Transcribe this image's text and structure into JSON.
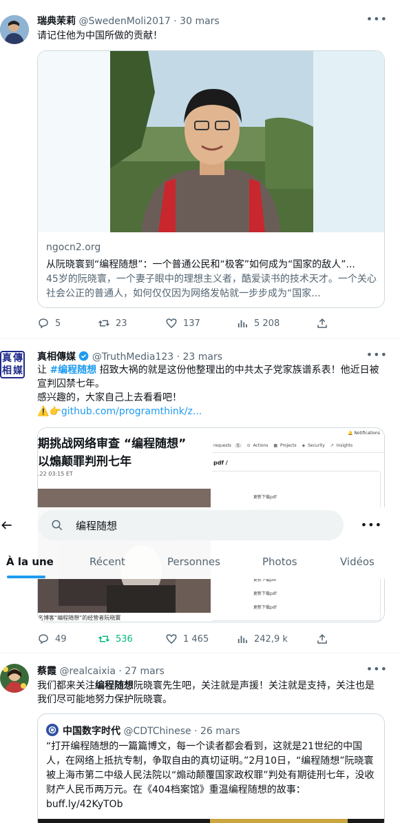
{
  "tweets": [
    {
      "name": "瑞典茉莉",
      "meta": "@SwedenMoli2017 · 30 mars",
      "text": "请记住他为中国所做的贡献！",
      "card": {
        "domain": "ngocn2.org",
        "title": "从阮晓寰到“编程随想”：一个普通公民和“极客”如何成为“国家的敌人”...",
        "desc": "45岁的阮晓寰，一个妻子眼中的理想主义者，酷爱读书的技术天才。一个关心社会公正的普通人，如何仅仅因为网络发帖就一步步成为“国家..."
      },
      "stats": {
        "replies": "5",
        "retweets": "23",
        "likes": "137",
        "views": "5 208"
      }
    },
    {
      "name": "真相傳媒",
      "meta": "@TruthMedia123 · 23 mars",
      "avatar_text": [
        "真",
        "傳",
        "相",
        "媒"
      ],
      "text_pre": "让 ",
      "hashtag": "#编程随想",
      "text_post": " 招致大祸的就是这份他整理出的中共太子党家族谱系表！他近日被宣判囚禁七年。",
      "text_line2": "感兴趣的，大家自己上去看看吧！",
      "emoji_warn": "⚠️",
      "emoji_point": "👉",
      "link": "github.com/programthink/z...",
      "news_headline_1": "期挑战网络审查 “编程随想”",
      "news_headline_2": "以煽颠罪判刑七年",
      "news_date": ".22 03:15 ET",
      "news_caption": "名博客“编程随想”的经营者阮晓寰",
      "gh_notifications": "Notifications",
      "gh_tabs": [
        "requests",
        "Actions",
        "Projects",
        "Security",
        "Insights"
      ],
      "gh_requests_count": "5",
      "gh_path": "pdf /",
      "gh_row_label": "更新下载pdf",
      "stats": {
        "replies": "49",
        "retweets": "536",
        "likes": "1 465",
        "views": "242,9 k"
      }
    },
    {
      "name": "蔡霞",
      "meta": "@realcaixia · 27 mars",
      "text_pre": "我们都来关注",
      "text_bold": "编程随想",
      "text_post": "阮晓寰先生吧，关注就是声援！关注就是支持，关注也是我们尽可能地努力保护阮晓寰。",
      "quote": {
        "name": "中国数字时代",
        "meta": "@CDTChinese · 26 mars",
        "text": "“打开编程随想的一篇篇博文，每一个读者都会看到，这就是21世纪的中国人，在网络上抵抗专制，争取自由的真切证明。”2月10日，“编程随想”阮晓寰被上海市第二中级人民法院以“煽动颠覆国家政权罪”判处有期徒刑七年，没收财产人民币两万元。在《404档案馆》重温编程随想的故事：buff.ly/42KyTOb"
      }
    }
  ],
  "search": {
    "query": "编程随想"
  },
  "tabs": [
    "À la une",
    "Récent",
    "Personnes",
    "Photos",
    "Vidéos"
  ],
  "colors": {
    "accent": "#1d9bf0",
    "green": "#00ba7c",
    "muted": "#536471",
    "border": "#cfd9de"
  }
}
